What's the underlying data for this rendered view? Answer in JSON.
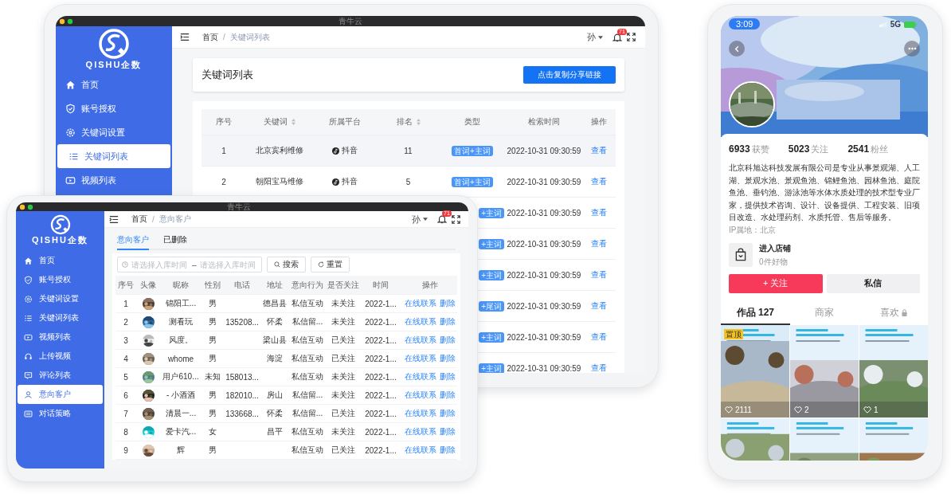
{
  "back_window": {
    "title": "青牛云",
    "logo": "QISHU企数",
    "sidebar": [
      {
        "label": "首页",
        "selected": false
      },
      {
        "label": "账号授权",
        "selected": false
      },
      {
        "label": "关键词设置",
        "selected": false
      },
      {
        "label": "关键词列表",
        "selected": true
      },
      {
        "label": "视频列表",
        "selected": false
      }
    ],
    "breadcrumb": [
      "首页",
      "关键词列表"
    ],
    "breadcrumb_separator": "/",
    "user": "孙",
    "notifications": "71",
    "page_title": "关键词列表",
    "share_button": "点击复制分享链接",
    "table": {
      "columns": [
        {
          "label": "序号",
          "sortable": false
        },
        {
          "label": "关键词",
          "sortable": true
        },
        {
          "label": "所属平台",
          "sortable": false
        },
        {
          "label": "排名",
          "sortable": true
        },
        {
          "label": "类型",
          "sortable": false
        },
        {
          "label": "检索时间",
          "sortable": false
        },
        {
          "label": "操作",
          "sortable": false
        }
      ],
      "rows": [
        {
          "highlighted": true,
          "index": "1",
          "keyword": "北京宾利维修",
          "platform": "抖音",
          "rank": "11",
          "type": "首词+主词",
          "time": "2022-10-31 09:30:59",
          "action": "查看"
        },
        {
          "highlighted": false,
          "index": "2",
          "keyword": "朝阳宝马维修",
          "platform": "抖音",
          "rank": "5",
          "type": "首词+主词",
          "time": "2022-10-31 09:30:59",
          "action": "查看"
        },
        {
          "highlighted": false,
          "type": "+主词",
          "time": "2022-10-31 09:30:59",
          "action": "查看"
        },
        {
          "highlighted": false,
          "type": "+主词",
          "time": "2022-10-31 09:30:59",
          "action": "查看"
        },
        {
          "highlighted": false,
          "type": "+主词",
          "time": "2022-10-31 09:30:59",
          "action": "查看"
        },
        {
          "highlighted": false,
          "type": "+尾词",
          "time": "2022-10-31 09:30:59",
          "action": "查看"
        },
        {
          "highlighted": false,
          "type": "+主词",
          "time": "2022-10-31 09:30:59",
          "action": "查看"
        },
        {
          "highlighted": false,
          "type": "+主词",
          "time": "2022-10-31 09:30:59",
          "action": "查看"
        }
      ]
    }
  },
  "front_window": {
    "title": "青牛云",
    "logo": "QISHU企数",
    "sidebar": [
      {
        "label": "首页",
        "selected": false
      },
      {
        "label": "账号授权",
        "selected": false
      },
      {
        "label": "关键词设置",
        "selected": false
      },
      {
        "label": "关键词列表",
        "selected": false
      },
      {
        "label": "视频列表",
        "selected": false
      },
      {
        "label": "上传视频",
        "selected": false
      },
      {
        "label": "评论列表",
        "selected": false
      },
      {
        "label": "意向客户",
        "selected": true
      },
      {
        "label": "对话策略",
        "selected": false
      }
    ],
    "breadcrumb": [
      "首页",
      "意向客户"
    ],
    "breadcrumb_separator": "/",
    "user": "孙",
    "notifications": "71",
    "tabs": [
      {
        "label": "意向客户",
        "selected": true
      },
      {
        "label": "已删除",
        "selected": false
      }
    ],
    "date_range": {
      "start_placeholder": "请选择入库时间",
      "separator": "–",
      "end_placeholder": "请选择入库时间"
    },
    "buttons": [
      "搜索",
      "重置"
    ],
    "table": {
      "columns": [
        "序号",
        "头像",
        "昵称",
        "性别",
        "电话",
        "地址",
        "意向行为",
        "是否关注",
        "时间",
        "操作"
      ],
      "rows": [
        {
          "index": "1",
          "nickname": "锦阳工...",
          "gender": "男",
          "address": "德昌县",
          "behavior": "私信互动",
          "followed": "未关注",
          "time": "2022-1...",
          "actions": [
            "在线联系",
            "删除"
          ]
        },
        {
          "index": "2",
          "nickname": "测看玩",
          "gender": "男",
          "phone": "135208...",
          "address": "怀柔",
          "behavior": "私信留...",
          "followed": "未关注",
          "time": "2022-1...",
          "actions": [
            "在线联系",
            "删除"
          ]
        },
        {
          "index": "3",
          "nickname": "风度。",
          "gender": "男",
          "address": "梁山县",
          "behavior": "私信互动",
          "followed": "已关注",
          "time": "2022-1...",
          "actions": [
            "在线联系",
            "删除"
          ]
        },
        {
          "index": "4",
          "nickname": "whome",
          "gender": "男",
          "address": "海淀",
          "behavior": "私信互动",
          "followed": "已关注",
          "time": "2022-1...",
          "actions": [
            "在线联系",
            "删除"
          ]
        },
        {
          "index": "5",
          "nickname": "用户610...",
          "gender": "未知",
          "phone": "158013...",
          "behavior": "私信互动",
          "followed": "未关注",
          "time": "2022-1...",
          "actions": [
            "在线联系",
            "删除"
          ]
        },
        {
          "index": "6",
          "nickname": "- 小酒酒",
          "gender": "男",
          "phone": "182010...",
          "address": "房山",
          "behavior": "私信留...",
          "followed": "未关注",
          "time": "2022-1...",
          "actions": [
            "在线联系",
            "删除"
          ]
        },
        {
          "index": "7",
          "nickname": "清晨一...",
          "gender": "男",
          "phone": "133668...",
          "address": "怀柔",
          "behavior": "私信留...",
          "followed": "已关注",
          "time": "2022-1...",
          "actions": [
            "在线联系",
            "删除"
          ]
        },
        {
          "index": "8",
          "nickname": "爱卡汽...",
          "gender": "女",
          "address": "昌平",
          "behavior": "私信互动",
          "followed": "未关注",
          "time": "2022-1...",
          "actions": [
            "在线联系",
            "删除"
          ]
        },
        {
          "index": "9",
          "nickname": "辉",
          "gender": "男",
          "behavior": "私信互动",
          "followed": "已关注",
          "time": "2022-1...",
          "actions": [
            "在线联系",
            "删除"
          ]
        }
      ]
    }
  },
  "phone": {
    "status_time": "3:09",
    "network": "5G",
    "stats": [
      {
        "value": "6933",
        "label": "获赞"
      },
      {
        "value": "5023",
        "label": "关注"
      },
      {
        "value": "2541",
        "label": "粉丝"
      }
    ],
    "bio": "北京科旭达科技发展有限公司是专业从事景观湖、人工湖、景观水池、景观鱼池、锦鲤鱼池、园林鱼池、庭院鱼池、垂钓池、游泳池等水体水质处理的技术型专业厂家，提供技术咨询、设计、设备提供、工程安装、旧项目改造、水处理药剂、水质托管、售后等服务。",
    "ip_location": "IP属地：北京",
    "shop": {
      "title": "进入店铺",
      "subtitle": "0件好物"
    },
    "follow_button": "+ 关注",
    "message_button": "私信",
    "tabs": [
      {
        "label": "作品 127",
        "selected": true,
        "locked": false
      },
      {
        "label": "商家",
        "selected": false,
        "locked": false
      },
      {
        "label": "喜欢",
        "selected": false,
        "locked": true
      }
    ],
    "posts": [
      {
        "kind": "picture",
        "badge": "置顶",
        "likes": "2111"
      },
      {
        "kind": "picture",
        "likes": "2"
      },
      {
        "kind": "picture",
        "likes": "1"
      },
      {
        "kind": "picture"
      },
      {
        "kind": "picture"
      },
      {
        "kind": "picture"
      }
    ]
  }
}
